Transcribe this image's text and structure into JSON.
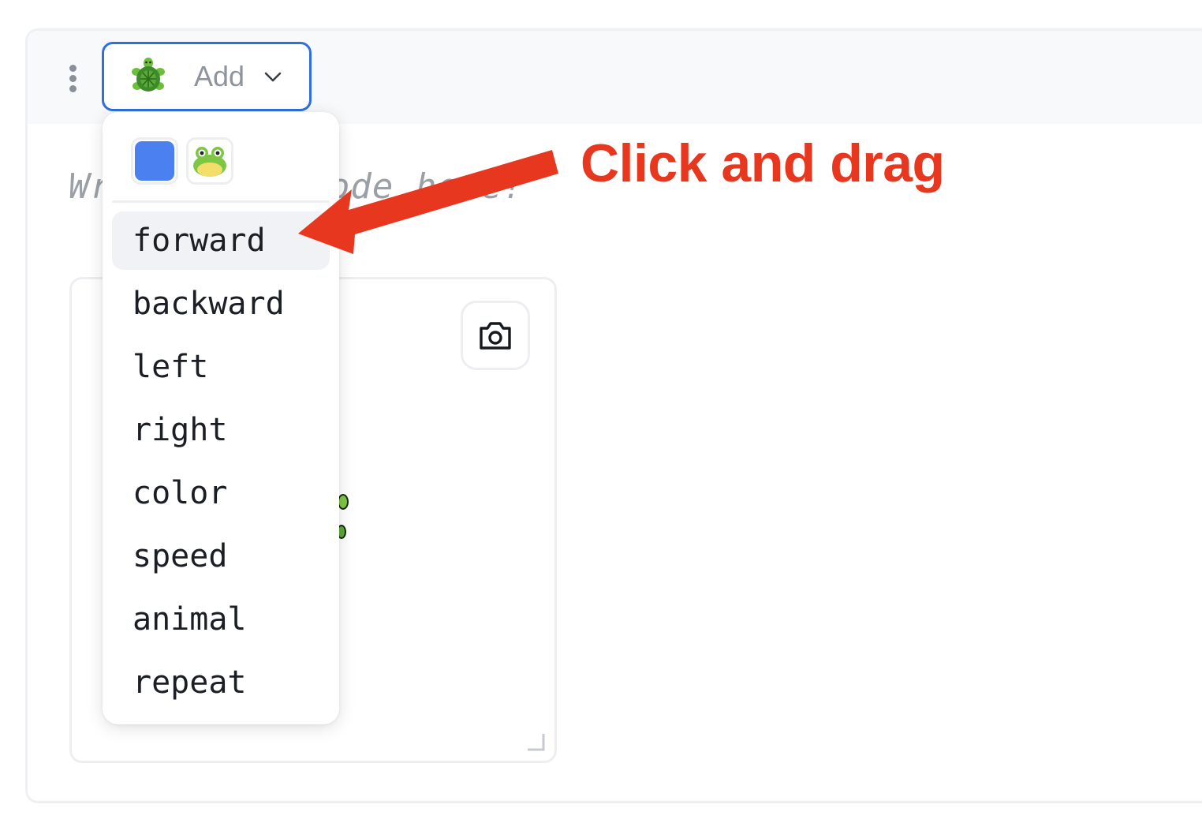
{
  "toolbar": {
    "menu_icon": "kebab-vertical-icon",
    "add_button": {
      "icon": "turtle-icon",
      "label": "Add",
      "caret_icon": "chevron-down-icon"
    }
  },
  "editor": {
    "placeholder": "Write your code here!"
  },
  "canvas": {
    "screenshot_icon": "camera-icon",
    "resize_icon": "resize-handle-icon"
  },
  "dropdown": {
    "swatches": [
      {
        "name": "color-swatch",
        "color": "#4a80ef"
      },
      {
        "name": "animal-swatch",
        "icon": "frog-icon"
      }
    ],
    "items": [
      "forward",
      "backward",
      "left",
      "right",
      "color",
      "speed",
      "animal",
      "repeat"
    ],
    "highlighted": "forward"
  },
  "annotation": {
    "text": "Click and drag",
    "color": "#e8371f"
  },
  "colors": {
    "accent": "#2f6fde",
    "annotation": "#e8371f"
  }
}
